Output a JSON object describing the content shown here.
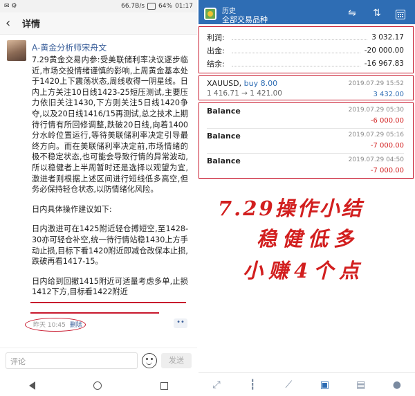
{
  "left": {
    "status": {
      "left_icons": "✉ ⚙",
      "signal": "66.7B/s",
      "battery": "64%",
      "time": "01:17"
    },
    "header": {
      "title": "详情"
    },
    "post": {
      "author": "A-黄金分析师宋舟文",
      "paragraphs": [
        "7.29黄金交易内参:受美联储利率决议逐步临近,市场交投情绪谨慎的影响,上周黄金基本处于1420上下震荡状态,周线收得一阴星线。日内上方关注10日线1423-25短压测试,主要压力依旧关注1430,下方则关注5日线1420争夺,以及20日线1416/15再测试,总之技术上期待行情有所回修调整,跌破20日线,向着1400分水岭位置运行,等待美联储利率决定引导最终方向。而在美联储利率决定前,市场情绪的极不稳定状态,也可能会导致行情的异常波动,所以稳健者上半周暂时还是选择以观望为宜,激进者则根据上述区间进行短线低多高空,但务必保持轻仓状态,以防情绪化风险。",
        "日内具体操作建议如下:",
        "日内激进可在1425附近轻仓搏短空,至1428-30亦可轻仓补空,统一待行情站稳1430上方手动止损,目标下看1420附近即减仓改保本止损,跌破再看1417-15。",
        "日内给到回撤1415附近可适量考虑多单,止损1412下方,目标看1422附近"
      ],
      "time": "昨天 10:45",
      "delete": "删除",
      "more": "••"
    },
    "comment": {
      "placeholder": "评论",
      "send": "发送"
    }
  },
  "right": {
    "header": {
      "title_small": "历史",
      "title": "全部交易品种"
    },
    "summary": [
      {
        "label": "利润:",
        "value": "3 032.17"
      },
      {
        "label": "出金:",
        "value": "-20 000.00"
      },
      {
        "label": "结余:",
        "value": "-16 967.83"
      }
    ],
    "deal": {
      "symbol": "XAUUSD,",
      "side": "buy 8.00",
      "prices": "1 416.71 → 1 421.00",
      "datetime": "2019.07.29 15:52",
      "amount": "3 432.00",
      "amount_color": "#2e6db4"
    },
    "balances": [
      {
        "name": "Balance",
        "datetime": "2019.07.29 05:30",
        "amount": "-6 000.00"
      },
      {
        "name": "Balance",
        "datetime": "2019.07.29 05:16",
        "amount": "-7 000.00"
      },
      {
        "name": "Balance",
        "datetime": "2019.07.29 04:50",
        "amount": "-7 000.00"
      }
    ],
    "handwriting": {
      "line1": "7.29操作小结",
      "line2": "稳健低多",
      "line3": "小赚4个点"
    },
    "nav": [
      "trade-icon",
      "chart-icon",
      "trend-icon",
      "history-icon",
      "news-icon",
      "chat-icon"
    ]
  },
  "colors": {
    "accent": "#2e6db4",
    "annotation": "#c8182d",
    "negative": "#d21f1f"
  }
}
